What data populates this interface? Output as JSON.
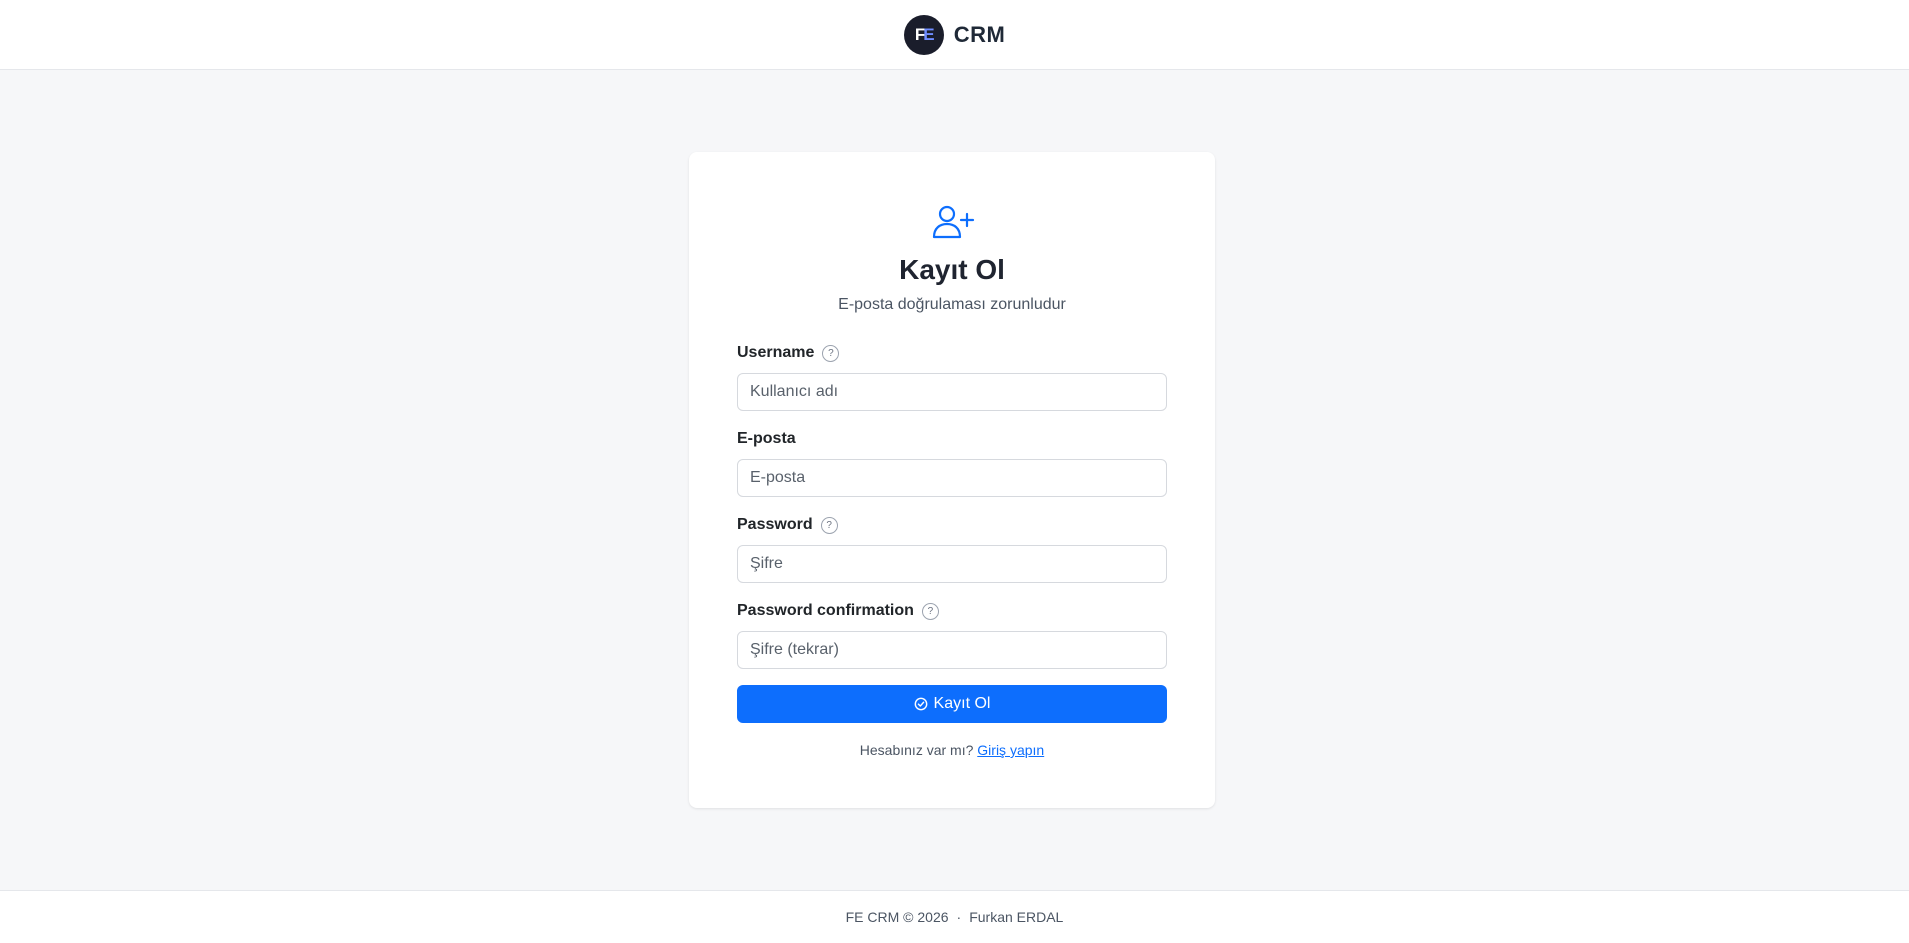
{
  "header": {
    "logo_text_f": "F",
    "logo_text_e": "E",
    "brand": "CRM"
  },
  "card": {
    "icon": "user-plus-icon",
    "title": "Kayıt Ol",
    "subtitle": "E-posta doğrulaması zorunludur"
  },
  "form": {
    "username": {
      "label": "Username",
      "placeholder": "Kullanıcı adı",
      "value": ""
    },
    "email": {
      "label": "E-posta",
      "placeholder": "E-posta",
      "value": ""
    },
    "password": {
      "label": "Password",
      "placeholder": "Şifre",
      "value": ""
    },
    "password_confirmation": {
      "label": "Password confirmation",
      "placeholder": "Şifre (tekrar)",
      "value": ""
    },
    "help_glyph": "?",
    "submit_label": "Kayıt Ol"
  },
  "login": {
    "prompt": "Hesabınız var mı?",
    "link": "Giriş yapın"
  },
  "footer": {
    "copyright": "FE CRM © 2026",
    "separator": "·",
    "author": "Furkan ERDAL"
  },
  "colors": {
    "accent": "#0d6efd",
    "logo_bg": "#1a1d2b",
    "page_bg": "#f6f7f9"
  }
}
